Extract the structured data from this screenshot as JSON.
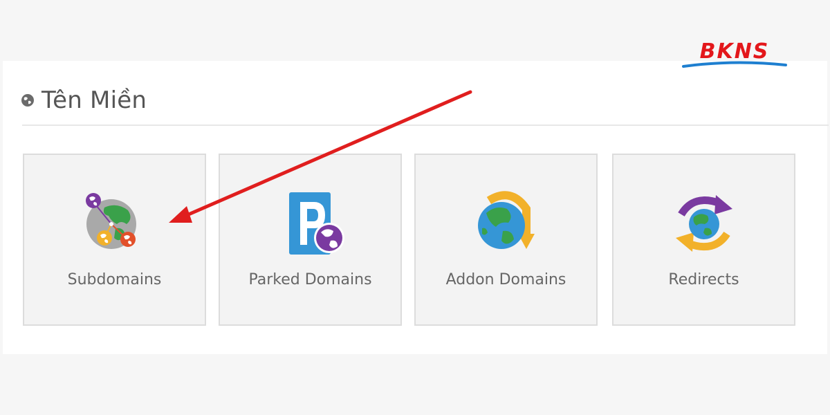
{
  "brand": {
    "logo_text": "BKNS",
    "colors": {
      "primary": "#e3171b",
      "accent": "#1e7fd0"
    }
  },
  "section": {
    "title": "Tên Miền",
    "icon": "globe-icon"
  },
  "tiles": [
    {
      "label": "Subdomains",
      "icon": "subdomains-icon"
    },
    {
      "label": "Parked Domains",
      "icon": "parked-domains-icon"
    },
    {
      "label": "Addon Domains",
      "icon": "addon-domains-icon"
    },
    {
      "label": "Redirects",
      "icon": "redirects-icon"
    }
  ],
  "annotation": {
    "arrow_color": "#e01e1e",
    "points_to": "Subdomains"
  }
}
